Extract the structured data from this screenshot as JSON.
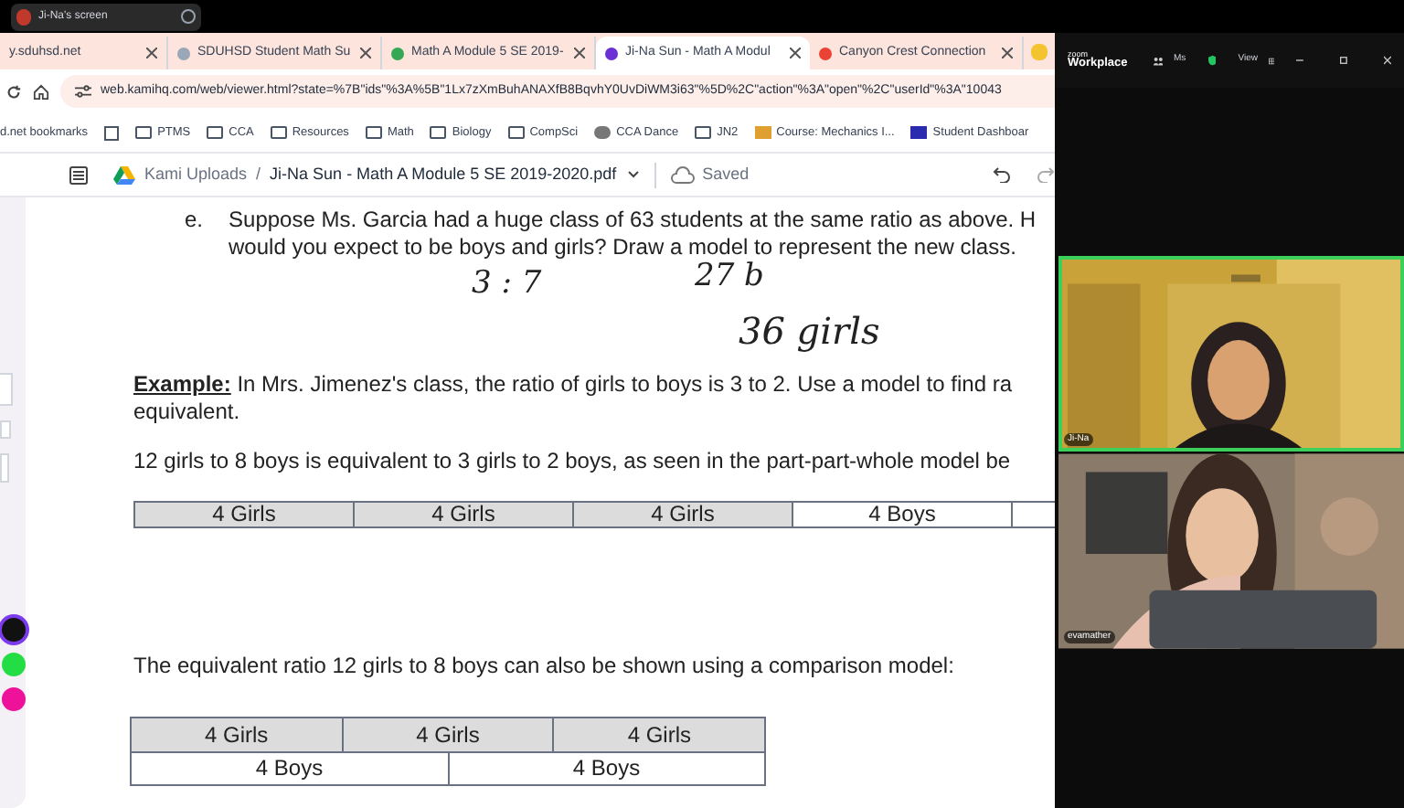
{
  "share_bar": {
    "label": "Ji-Na's screen"
  },
  "tabs": [
    {
      "label": "y.sduhsd.net",
      "selected": false
    },
    {
      "label": "SDUHSD Student Math Su",
      "selected": false
    },
    {
      "label": "Math A Module 5 SE 2019-",
      "selected": false
    },
    {
      "label": "Ji-Na Sun - Math A Modul",
      "selected": true
    },
    {
      "label": "Canyon Crest Connection",
      "selected": false
    }
  ],
  "address_bar": {
    "url": "web.kamihq.com/web/viewer.html?state=%7B\"ids\"%3A%5B\"1Lx7zXmBuhANAXfB8BqvhY0UvDiWM3i63\"%5D%2C\"action\"%3A\"open\"%2C\"userId\"%3A\"10043"
  },
  "bookmarks": [
    "d.net bookmarks",
    "PTMS",
    "CCA",
    "Resources",
    "Math",
    "Biology",
    "CompSci",
    "CCA Dance",
    "JN2",
    "Course: Mechanics I...",
    "Student Dashboar"
  ],
  "kami_toolbar": {
    "folder": "Kami Uploads",
    "separator": "/",
    "file": "Ji-Na Sun - Math A Module 5 SE 2019-2020.pdf",
    "status": "Saved"
  },
  "tools": {
    "colors": [
      {
        "color": "#111111",
        "selected": true
      },
      {
        "color": "#22dd44",
        "selected": false
      },
      {
        "color": "#ee1199",
        "selected": false
      }
    ]
  },
  "document": {
    "question": {
      "marker": "e.",
      "lines": [
        "Suppose Ms. Garcia had a huge class of 63 students at the same ratio as above. H",
        "would you expect to be boys and girls?  Draw a model to represent the new class."
      ]
    },
    "handwriting": [
      "3 : 7",
      "27 b",
      "36 girls"
    ],
    "example_lines": [
      "**Example:** In Mrs. Jimenez's class, the ratio of girls to boys is 3 to 2.  Use a model to find ra",
      "equivalent."
    ],
    "sentence_1": "12 girls to 8 boys is equivalent to 3 girls to 2 boys, as seen in the part-part-whole model be",
    "part_part_whole": [
      {
        "label": "4 Girls",
        "kind": "girls"
      },
      {
        "label": "4 Girls",
        "kind": "girls"
      },
      {
        "label": "4 Girls",
        "kind": "girls"
      },
      {
        "label": "4 Boys",
        "kind": "boys"
      },
      {
        "kind": "boys"
      }
    ],
    "sentence_2": "The equivalent ratio 12 girls to 8 boys can also be shown using a comparison model:",
    "comparison": {
      "girls": [
        "4 Girls",
        "4 Girls",
        "4 Girls"
      ],
      "boys": [
        "4 Boys",
        "4 Boys"
      ]
    }
  },
  "zoom": {
    "brand_small": "zoom",
    "brand": "Workplace",
    "participants": "Ms",
    "view": "View",
    "tiles": [
      {
        "name": "Ji-Na",
        "speaking": true
      },
      {
        "name": "evamather",
        "speaking": false
      }
    ]
  }
}
